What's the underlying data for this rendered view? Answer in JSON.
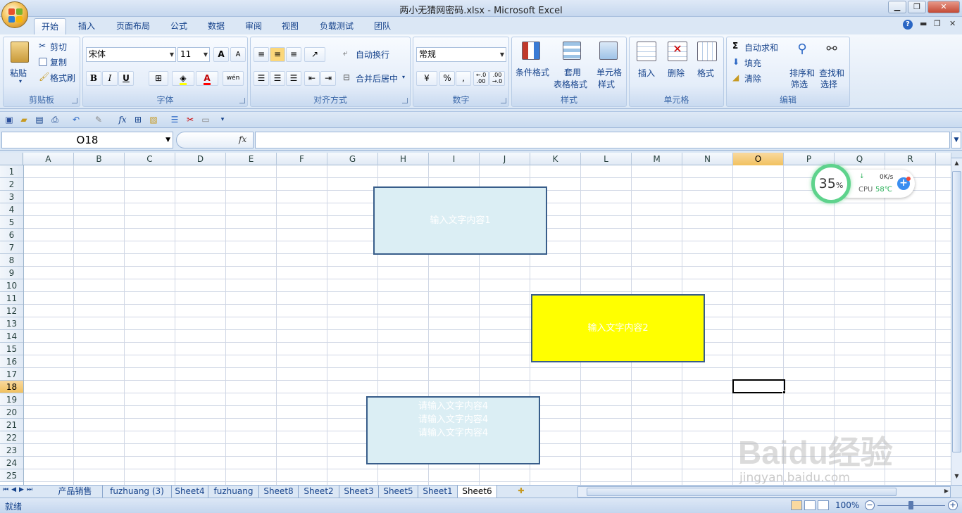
{
  "window": {
    "title": "两小无猜网密码.xlsx - Microsoft Excel",
    "minimize": "▁",
    "restore": "❐",
    "close": "✕"
  },
  "tabs": [
    "开始",
    "插入",
    "页面布局",
    "公式",
    "数据",
    "审阅",
    "视图",
    "负载测试",
    "团队"
  ],
  "ribbon": {
    "clipboard": {
      "label": "剪贴板",
      "paste": "粘贴",
      "cut": "剪切",
      "copy": "复制",
      "format_painter": "格式刷"
    },
    "font": {
      "label": "字体",
      "font_name": "宋体",
      "font_size": "11",
      "grow": "A",
      "shrink": "A",
      "bold": "B",
      "italic": "I",
      "underline": "U",
      "phonetic": "wén"
    },
    "alignment": {
      "label": "对齐方式",
      "wrap": "自动换行",
      "merge": "合并后居中"
    },
    "number": {
      "label": "数字",
      "format": "常规",
      "percent": "%",
      "comma": ",",
      "inc_decimal": "←.0 .00",
      "dec_decimal": ".00 →.0"
    },
    "styles": {
      "label": "样式",
      "conditional": "条件格式",
      "table_1": "套用",
      "table_2": "表格格式",
      "cell_styles_1": "单元格",
      "cell_styles_2": "样式"
    },
    "cells": {
      "label": "单元格",
      "insert": "插入",
      "delete": "删除",
      "format": "格式"
    },
    "editing": {
      "label": "编辑",
      "autosum": "自动求和",
      "fill": "填充",
      "clear": "清除",
      "sort_1": "排序和",
      "sort_2": "筛选",
      "find_1": "查找和",
      "find_2": "选择"
    }
  },
  "formula_bar": {
    "name_box": "O18",
    "fx": "fx",
    "value": ""
  },
  "columns": [
    "A",
    "B",
    "C",
    "D",
    "E",
    "F",
    "G",
    "H",
    "I",
    "J",
    "K",
    "L",
    "M",
    "N",
    "O",
    "P",
    "Q",
    "R"
  ],
  "rows": [
    "1",
    "2",
    "3",
    "4",
    "5",
    "6",
    "7",
    "8",
    "9",
    "10",
    "11",
    "12",
    "13",
    "14",
    "15",
    "16",
    "17",
    "18",
    "19",
    "20",
    "21",
    "22",
    "23",
    "24",
    "25"
  ],
  "selected_column": "O",
  "selected_row": "18",
  "shapes": [
    {
      "text": "输入文字内容1",
      "fill": "#dbeef4"
    },
    {
      "text": "输入文字内容2",
      "fill": "#ffff00"
    },
    {
      "text": "请输入文字内容4 请输入文字内容4 请输入文字内容4 请输入文字内容4",
      "fill": "#dbeef4"
    }
  ],
  "shape4_lines": [
    "请输入文字内容4",
    "请输入文字内容4",
    "请输入文字内容4"
  ],
  "widget": {
    "cpu_percent": "35",
    "percent_sign": "%",
    "net_speed": "0K/s",
    "cpu_label": "CPU",
    "cpu_temp": "58℃"
  },
  "sheets": [
    "产品销售",
    "fuzhuang (3)",
    "Sheet4",
    "fuzhuang",
    "Sheet8",
    "Sheet2",
    "Sheet3",
    "Sheet5",
    "Sheet1",
    "Sheet6"
  ],
  "active_sheet": "Sheet6",
  "status": {
    "mode": "就绪",
    "zoom": "100%"
  },
  "watermark": {
    "text": "Baidu经验",
    "url": "jingyan.baidu.com"
  }
}
